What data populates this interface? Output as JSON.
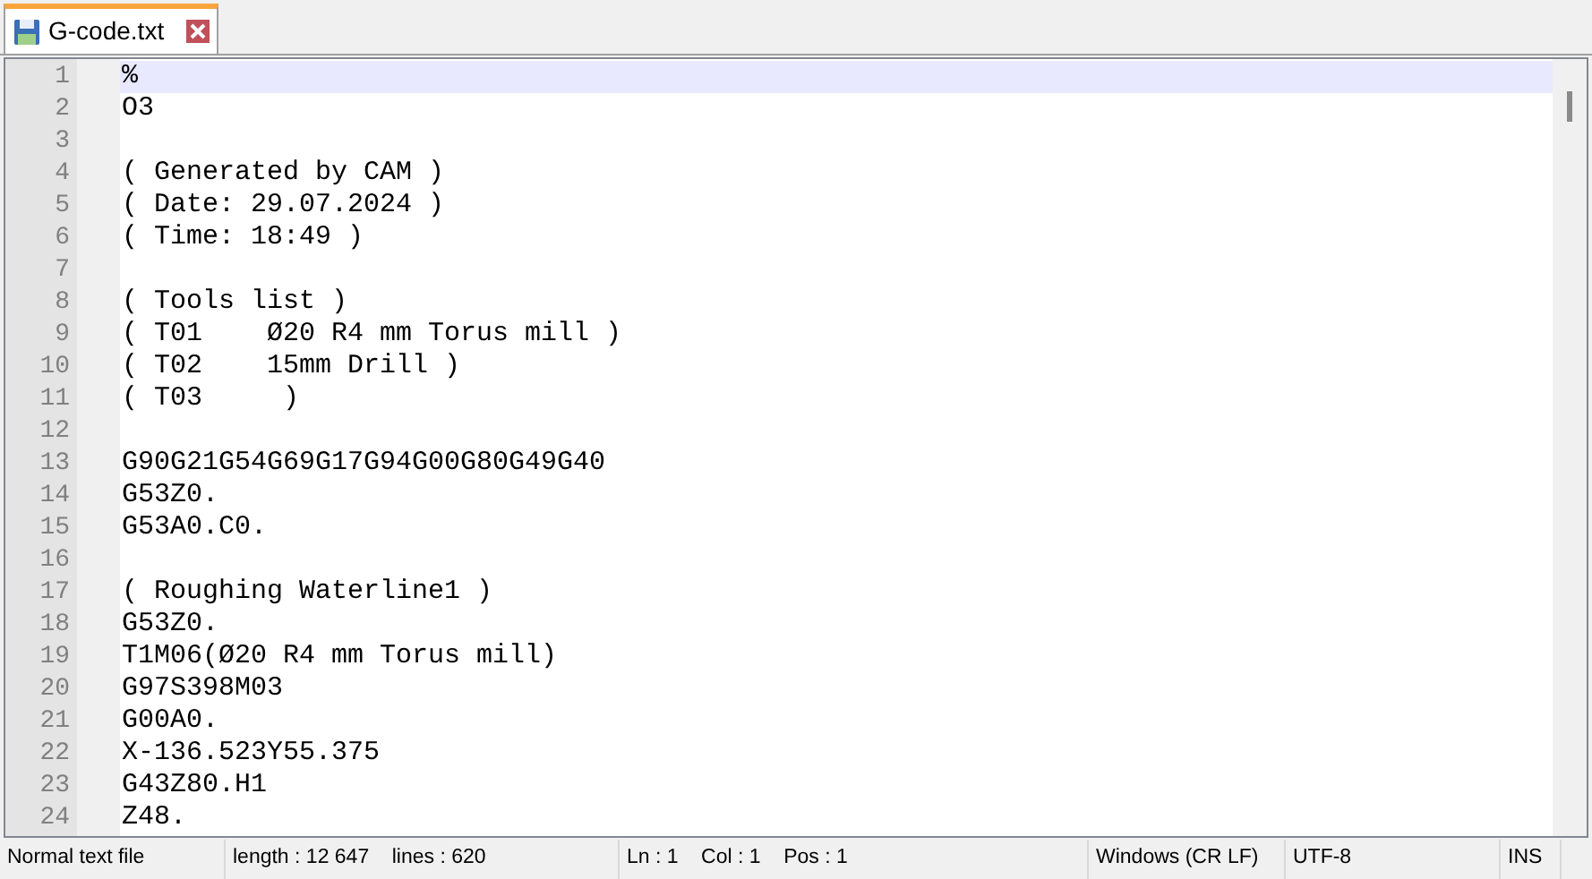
{
  "tabs": [
    {
      "label": "G-code.txt",
      "selected": true
    }
  ],
  "editor": {
    "lines": [
      {
        "number": "1",
        "text": "%",
        "current": true
      },
      {
        "number": "2",
        "text": "O3",
        "current": false
      },
      {
        "number": "3",
        "current": false
      },
      {
        "number": "4",
        "text": "( Generated by CAM )",
        "current": false
      },
      {
        "number": "5",
        "text": "( Date: 29.07.2024 )",
        "current": false
      },
      {
        "number": "6",
        "text": "( Time: 18:49 )",
        "current": false
      },
      {
        "number": "7",
        "current": false
      },
      {
        "number": "8",
        "text": "( Tools list )",
        "current": false
      },
      {
        "number": "9",
        "text": "( T01    Ø20 R4 mm Torus mill )",
        "current": false
      },
      {
        "number": "10",
        "text": "( T02    15mm Drill )",
        "current": false
      },
      {
        "number": "11",
        "text": "( T03     )",
        "current": false
      },
      {
        "number": "12",
        "current": false
      },
      {
        "number": "13",
        "text": "G90G21G54G69G17G94G00G80G49G40",
        "current": false
      },
      {
        "number": "14",
        "text": "G53Z0.",
        "current": false
      },
      {
        "number": "15",
        "text": "G53A0.C0.",
        "current": false
      },
      {
        "number": "16",
        "current": false
      },
      {
        "number": "17",
        "text": "( Roughing Waterline1 )",
        "current": false
      },
      {
        "number": "18",
        "text": "G53Z0.",
        "current": false
      },
      {
        "number": "19",
        "text": "T1M06(Ø20 R4 mm Torus mill)",
        "current": false
      },
      {
        "number": "20",
        "text": "G97S398M03",
        "current": false
      },
      {
        "number": "21",
        "text": "G00A0.",
        "current": false
      },
      {
        "number": "22",
        "text": "X-136.523Y55.375",
        "current": false
      },
      {
        "number": "23",
        "text": "G43Z80.H1",
        "current": false
      },
      {
        "number": "24",
        "text": "Z48.",
        "current": false
      }
    ]
  },
  "status_bar": [
    "Normal text file",
    "length : 12 647    lines : 620",
    "Ln : 1    Col : 1    Pos : 1",
    "Windows (CR LF)",
    "UTF-8",
    "INS"
  ]
}
